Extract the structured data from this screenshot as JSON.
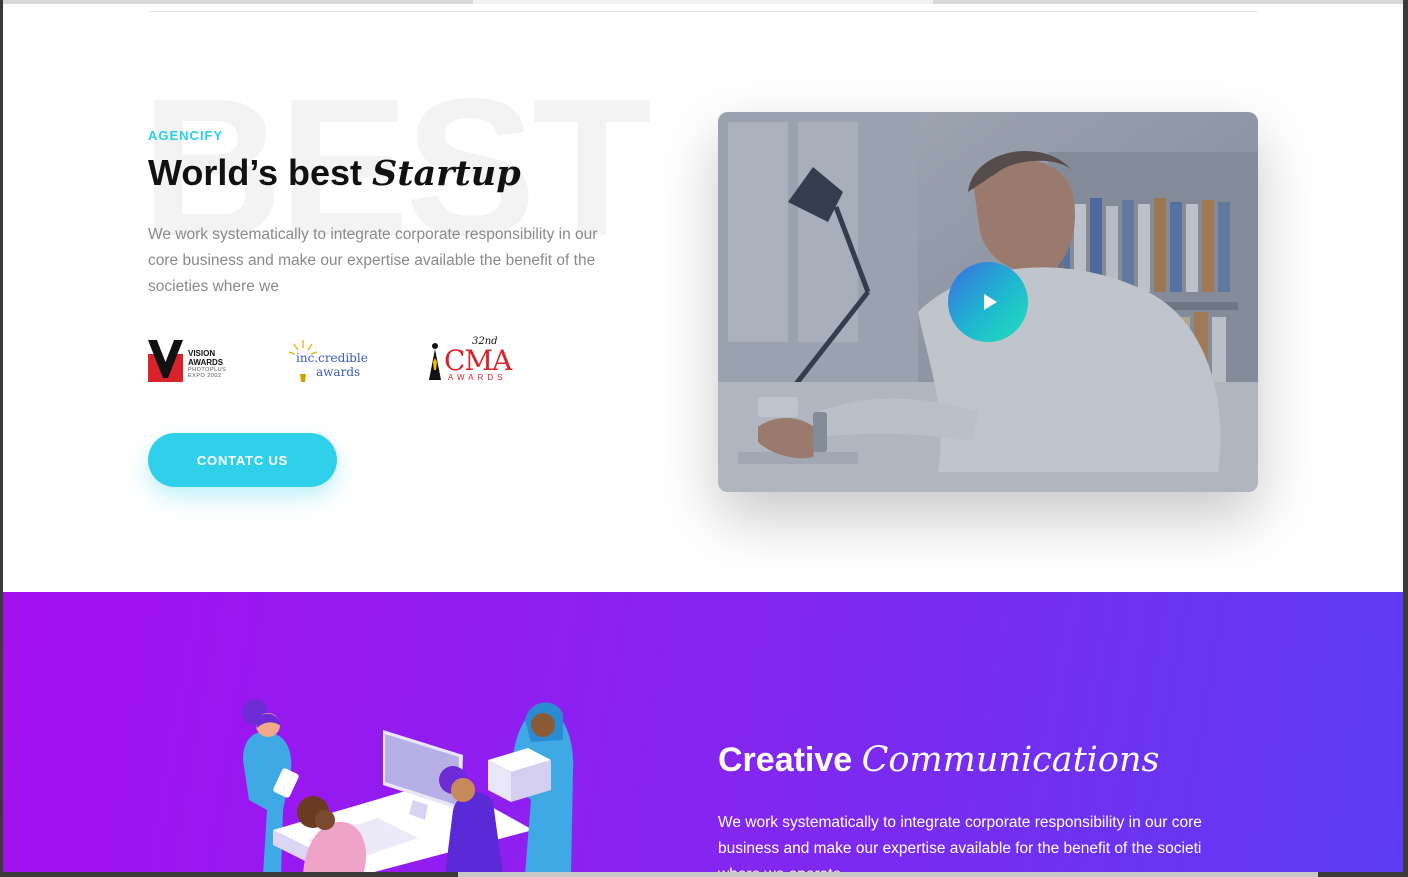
{
  "hero": {
    "bg_word": "BEST",
    "eyebrow": "AGENCIFY",
    "title_main": "World’s best ",
    "title_accent": "Startup",
    "text": "We work systematically to integrate corporate responsibility in our core business and make our expertise available the benefit of the societies where we",
    "cta_label": "CONTATC US"
  },
  "awards": {
    "vision": {
      "line1": "VISION",
      "line2": "AWARDS",
      "sub1": "PHOTOPLUS",
      "sub2": "EXPO 2002"
    },
    "incredible": {
      "line1": "inc.credible",
      "line2": "awards"
    },
    "cma": {
      "ordinal": "32nd",
      "name": "CMA",
      "sub": "AWARDS"
    }
  },
  "video": {
    "play_icon": "play-icon"
  },
  "communications": {
    "title_main": "Creative ",
    "title_accent": "Communications",
    "text": "We work systematically to integrate corporate responsibility in our core business and make our expertise available for the benefit of the societi where we operate"
  },
  "colors": {
    "accent_cyan": "#2fd0ea",
    "purple_start": "#a50ff0",
    "purple_end": "#5c3cf2"
  }
}
